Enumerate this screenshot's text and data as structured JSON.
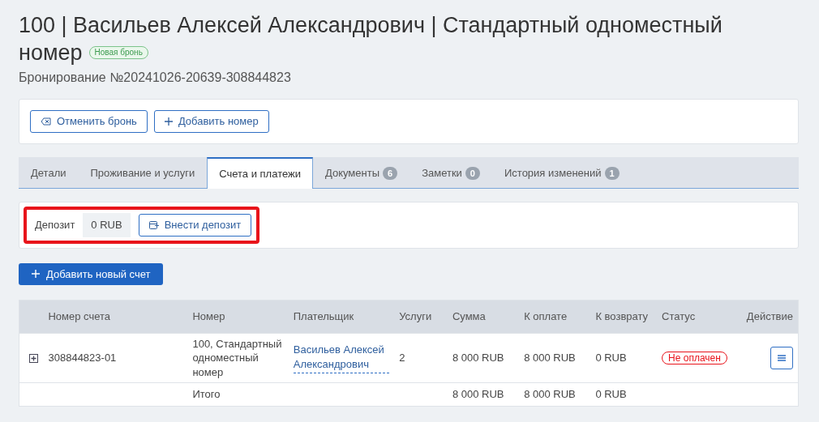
{
  "header": {
    "title_lines": [
      "100 | Васильев Алексей Александрович | Стандартный одноместный",
      "номер"
    ],
    "status_badge": "Новая бронь",
    "subtitle": "Бронирование №20241026-20639-308844823"
  },
  "actions": [
    {
      "kind": "cancel",
      "label": "Отменить бронь"
    },
    {
      "kind": "add",
      "label": "Добавить номер"
    }
  ],
  "tabs": [
    {
      "label": "Детали",
      "selected": false
    },
    {
      "label": "Проживание и услуги",
      "selected": false
    },
    {
      "label": "Счета и платежи",
      "selected": true
    },
    {
      "label": "Документы",
      "count": "6",
      "selected": false
    },
    {
      "label": "Заметки",
      "count": "0",
      "selected": false
    },
    {
      "label": "История изменений",
      "count": "1",
      "selected": false
    }
  ],
  "deposit": {
    "label": "Депозит",
    "amount": "0 RUB",
    "button": "Внести депозит",
    "highlighted": true
  },
  "add_invoice_button": "Добавить новый счет",
  "table": {
    "columns": [
      "Номер счета",
      "Номер",
      "Плательщик",
      "Услуги",
      "Сумма",
      "К оплате",
      "К возврату",
      "Статус",
      "Действие"
    ],
    "rows": [
      {
        "expanded": false,
        "number": "308844823-01",
        "room": "100, Стандартный одноместный номер",
        "payer": "Васильев Алексей Александрович",
        "services": "2",
        "sum": "8 000 RUB",
        "to_pay": "8 000 RUB",
        "refund": "0 RUB",
        "status": "Не оплачен"
      }
    ],
    "total": {
      "label": "Итого",
      "sum": "8 000 RUB",
      "to_pay": "8 000 RUB",
      "refund": "0 RUB"
    }
  }
}
